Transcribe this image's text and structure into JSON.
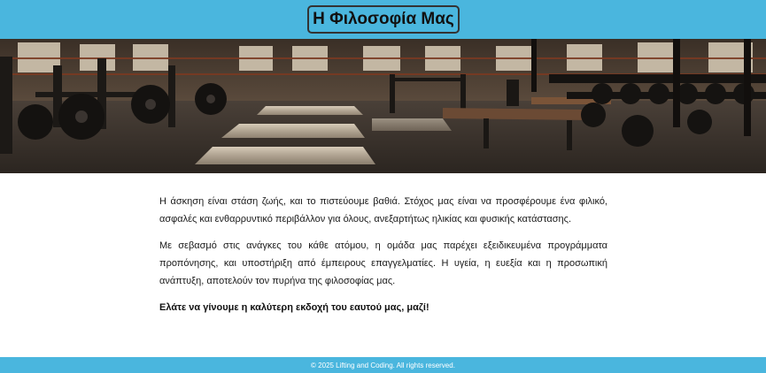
{
  "header": {
    "title": "Η Φιλοσοφία Μας",
    "background_color": "#4ab6de"
  },
  "hero": {
    "image_subject": "gym-interior-image"
  },
  "main": {
    "paragraphs": [
      "Η άσκηση είναι στάση ζωής, και το πιστεύουμε βαθιά. Στόχος μας είναι να προσφέρουμε ένα φιλικό, ασφαλές και ενθαρρυντικό περιβάλλον για όλους, ανεξαρτήτως ηλικίας και φυσικής κατάστασης.",
      "Με σεβασμό στις ανάγκες του κάθε ατόμου, η ομάδα μας παρέχει εξειδικευμένα προγράμματα προπόνησης, και υποστήριξη από έμπειρους επαγγελματίες. Η υγεία, η ευεξία και η προσωπική ανάπτυξη, αποτελούν τον πυρήνα της φιλοσοφίας μας."
    ],
    "closing": "Ελάτε να γίνουμε η καλύτερη εκδοχή του εαυτού μας, μαζί!"
  },
  "footer": {
    "copyright": "© 2025 Lifting and Coding. All rights reserved."
  }
}
